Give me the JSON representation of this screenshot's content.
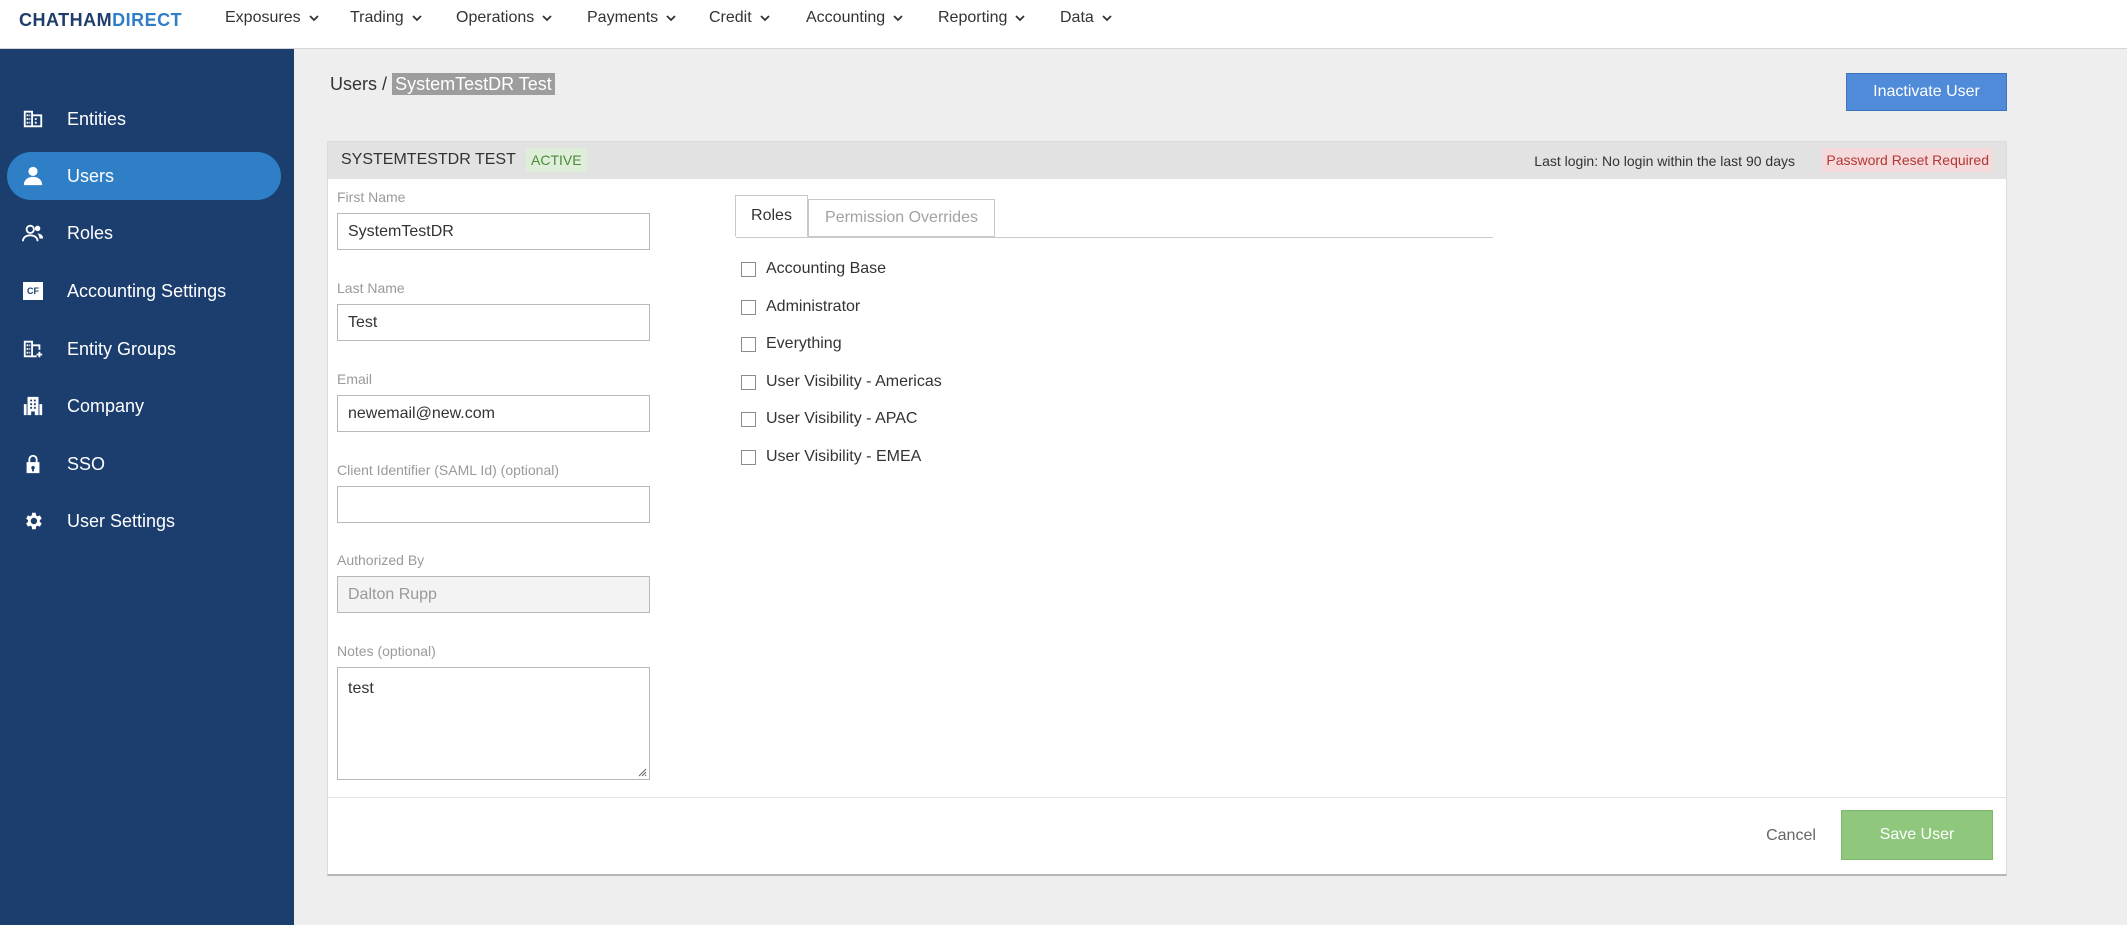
{
  "brand": {
    "part1": "CHATHAM",
    "part2": "DIRECT"
  },
  "topnav": {
    "items": [
      {
        "label": "Exposures"
      },
      {
        "label": "Trading"
      },
      {
        "label": "Operations"
      },
      {
        "label": "Payments"
      },
      {
        "label": "Credit"
      },
      {
        "label": "Accounting"
      },
      {
        "label": "Reporting"
      },
      {
        "label": "Data"
      }
    ]
  },
  "sidebar": {
    "items": [
      {
        "label": "Entities",
        "icon": "building-icon"
      },
      {
        "label": "Users",
        "icon": "user-icon",
        "active": true
      },
      {
        "label": "Roles",
        "icon": "people-icon"
      },
      {
        "label": "Accounting Settings",
        "icon": "cf-icon",
        "icon_text": "CF"
      },
      {
        "label": "Entity Groups",
        "icon": "building-group-icon"
      },
      {
        "label": "Company",
        "icon": "company-icon"
      },
      {
        "label": "SSO",
        "icon": "lock-icon"
      },
      {
        "label": "User Settings",
        "icon": "gear-icon"
      }
    ]
  },
  "breadcrumb": {
    "root": "Users",
    "separator": "/",
    "current": "SystemTestDR Test"
  },
  "actions": {
    "inactivate": "Inactivate User"
  },
  "user": {
    "title": "SYSTEMTESTDR TEST",
    "status": "ACTIVE",
    "last_login": "Last login: No login within the last 90 days",
    "password_badge": "Password Reset Required"
  },
  "form": {
    "first_name": {
      "label": "First Name",
      "value": "SystemTestDR"
    },
    "last_name": {
      "label": "Last Name",
      "value": "Test"
    },
    "email": {
      "label": "Email",
      "value": "newemail@new.com"
    },
    "client_id": {
      "label": "Client Identifier (SAML Id) (optional)",
      "value": ""
    },
    "authorized_by": {
      "label": "Authorized By",
      "value": "Dalton Rupp"
    },
    "notes": {
      "label": "Notes (optional)",
      "value": "test"
    }
  },
  "tabs": {
    "roles": "Roles",
    "overrides": "Permission Overrides"
  },
  "roles": [
    {
      "label": "Accounting Base",
      "checked": false
    },
    {
      "label": "Administrator",
      "checked": false
    },
    {
      "label": "Everything",
      "checked": false
    },
    {
      "label": "User Visibility - Americas",
      "checked": false
    },
    {
      "label": "User Visibility - APAC",
      "checked": false
    },
    {
      "label": "User Visibility - EMEA",
      "checked": false
    }
  ],
  "footer": {
    "cancel": "Cancel",
    "save": "Save User"
  },
  "colors": {
    "sidebar_bg": "#1c3e6e",
    "sidebar_active": "#2f7fc6",
    "primary_button": "#4f8bd9",
    "save_button": "#8fc77c",
    "active_badge_text": "#4a8a3a",
    "password_badge_text": "#b33636"
  }
}
